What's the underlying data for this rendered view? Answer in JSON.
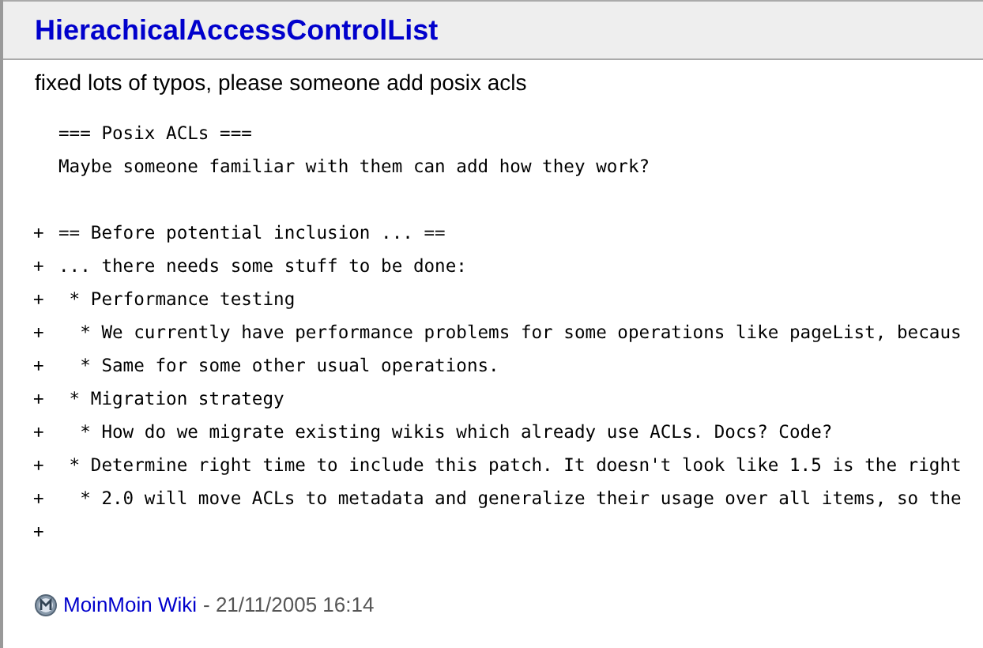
{
  "title": "HierachicalAccessControlList",
  "comment": "fixed lots of typos, please someone add posix acls",
  "context_lines": [
    "=== Posix ACLs ===",
    "Maybe someone familiar with them can add how they work?"
  ],
  "added_lines": [
    {
      "marker": "+",
      "text": "== Before potential inclusion ... =="
    },
    {
      "marker": "+",
      "text": "... there needs some stuff to be done:"
    },
    {
      "marker": "+",
      "text": " * Performance testing"
    },
    {
      "marker": "+",
      "text": "  * We currently have performance problems for some operations like pageList, becaus"
    },
    {
      "marker": "+",
      "text": "  * Same for some other usual operations."
    },
    {
      "marker": "+",
      "text": " * Migration strategy"
    },
    {
      "marker": "+",
      "text": "  * How do we migrate existing wikis which already use ACLs. Docs? Code?"
    },
    {
      "marker": "+",
      "text": " * Determine right time to include this patch. It doesn't look like 1.5 is the right"
    },
    {
      "marker": "+",
      "text": "  * 2.0 will move ACLs to metadata and generalize their usage over all items, so the"
    },
    {
      "marker": "+"
    }
  ],
  "footer": {
    "link": "MoinMoin Wiki",
    "date": "- 21/11/2005 16:14"
  }
}
